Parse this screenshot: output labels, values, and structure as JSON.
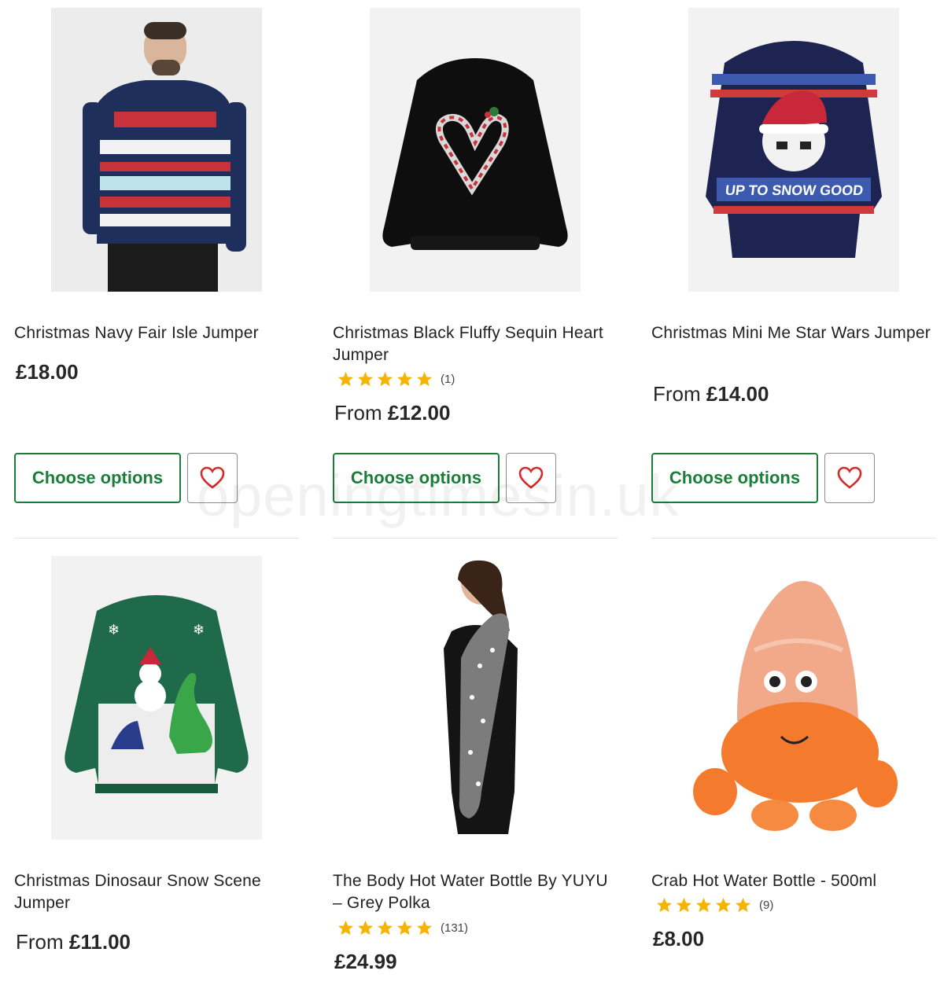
{
  "watermark": "openingtimesin.uk",
  "products": [
    {
      "name": "Christmas Navy Fair Isle Jumper",
      "price_prefix": "",
      "price": "£18.00",
      "rating_count": "",
      "button": "Choose options"
    },
    {
      "name": "Christmas Black Fluffy Sequin Heart Jumper",
      "price_prefix": "From",
      "price": "£12.00",
      "rating_count": "(1)",
      "button": "Choose options"
    },
    {
      "name": "Christmas Mini Me Star Wars Jumper",
      "price_prefix": "From",
      "price": "£14.00",
      "rating_count": "",
      "button": "Choose options"
    },
    {
      "name": "Christmas Dinosaur Snow Scene Jumper",
      "price_prefix": "From",
      "price": "£11.00",
      "rating_count": ""
    },
    {
      "name": "The Body Hot Water Bottle By YUYU – Grey Polka",
      "price_prefix": "",
      "price": "£24.99",
      "rating_count": "(131)"
    },
    {
      "name": "Crab Hot Water Bottle - 500ml",
      "price_prefix": "",
      "price": "£8.00",
      "rating_count": "(9)"
    }
  ],
  "colors": {
    "accent_green": "#1a7d3a",
    "star": "#f4b400",
    "heart": "#d42a2a"
  },
  "icons": {
    "wishlist": "heart-icon",
    "rating": "star-icon"
  }
}
